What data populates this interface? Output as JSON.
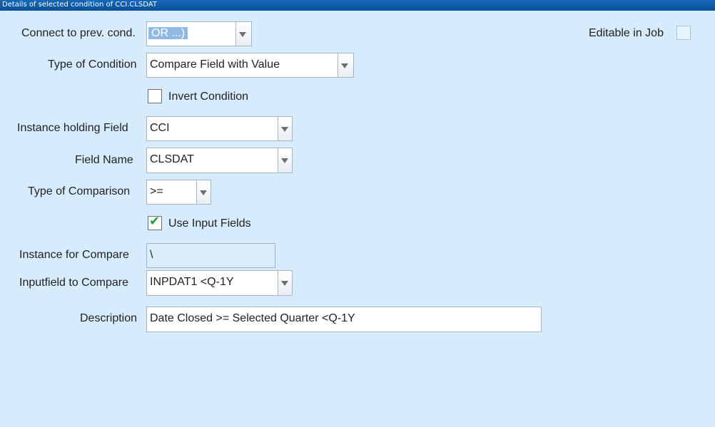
{
  "window": {
    "title": "Details of selected condition of CCI.CLSDAT"
  },
  "form": {
    "connect_label": "Connect to prev. cond.",
    "connect_value": "OR ...)",
    "editable_label": "Editable in Job",
    "editable_checked": false,
    "type_condition_label": "Type of Condition",
    "type_condition_value": "Compare Field with Value",
    "invert_label": "Invert Condition",
    "invert_checked": false,
    "instance_field_label": "Instance holding Field",
    "instance_field_value": "CCI",
    "field_name_label": "Field Name",
    "field_name_value": "CLSDAT",
    "comparison_label": "Type of Comparison",
    "comparison_value": ">=",
    "use_input_label": "Use Input Fields",
    "use_input_checked": true,
    "instance_compare_label": "Instance for Compare",
    "instance_compare_value": "\\",
    "inputfield_label": "Inputfield to Compare",
    "inputfield_value": "INPDAT1 <Q-1Y",
    "description_label": "Description",
    "description_value": "Date Closed >= Selected Quarter <Q-1Y"
  },
  "icons": {
    "dropdown": "chevron-down-icon",
    "check": "checkmark-icon"
  },
  "colors": {
    "background": "#d6ecfc",
    "titlebar": "#0a4f99",
    "check": "#27a23a",
    "selection": "#8fb8e2"
  }
}
